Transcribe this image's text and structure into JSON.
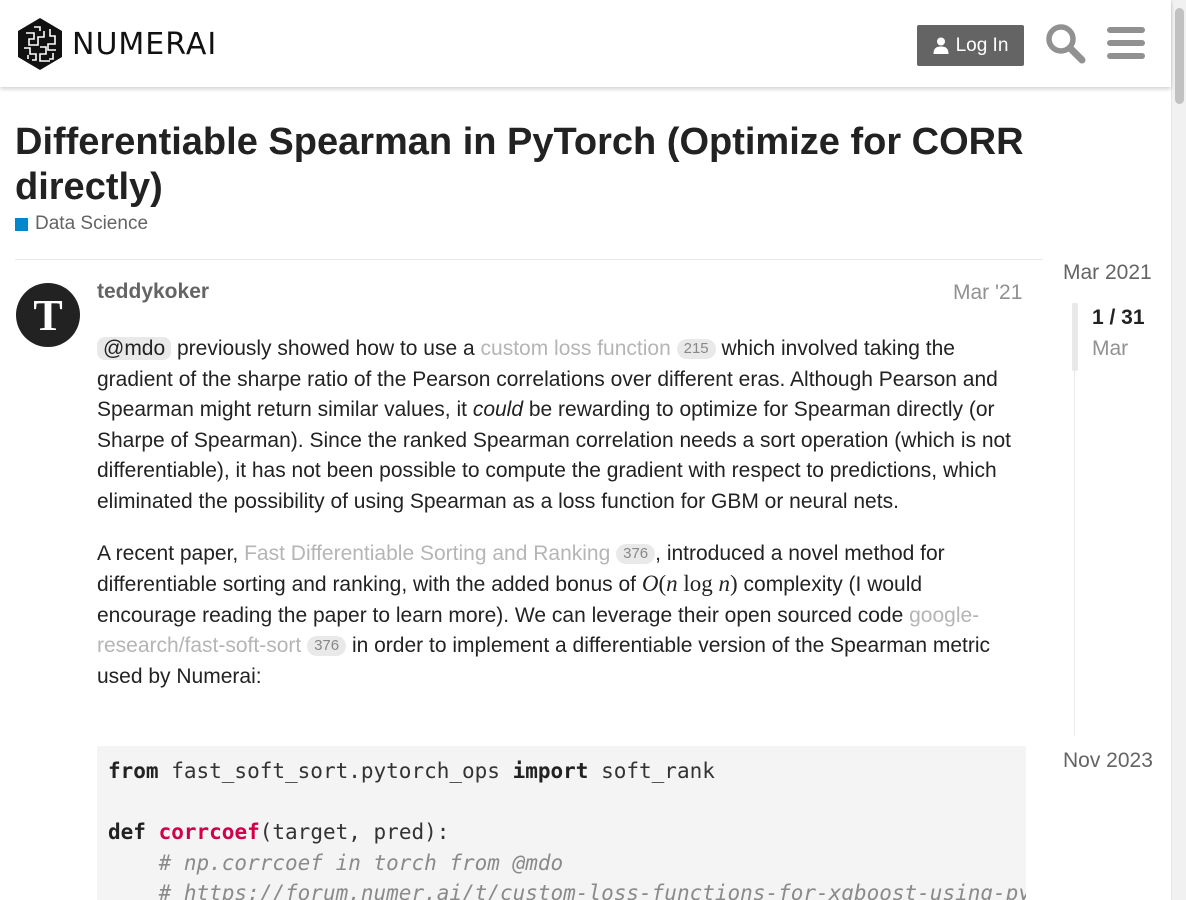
{
  "header": {
    "logo_text": "NUMERAI",
    "login_label": "Log In",
    "icons": [
      "numerai-logo-icon",
      "user-icon",
      "search-icon",
      "hamburger-menu-icon"
    ]
  },
  "topic": {
    "title": "Differentiable Spearman in PyTorch (Optimize for CORR directly)",
    "category": "Data Science",
    "category_color": "#0088cc"
  },
  "post": {
    "avatar_letter": "T",
    "username": "teddykoker",
    "date": "Mar '21",
    "p1": {
      "mention": "@mdo",
      "t1": " previously showed how to use a ",
      "link": "custom loss function",
      "clicks": "215",
      "t2": " which involved taking the gradient of the sharpe ratio of the Pearson correlations over different eras. Although Pearson and Spearman might return similar values, it ",
      "em": "could",
      "t3": " be rewarding to optimize for Spearman directly (or Sharpe of Spearman). Since the ranked Spearman correlation needs a sort operation (which is not differentiable), it has not been possible to compute the gradient with respect to predictions, which eliminated the possibility of using Spearman as a loss function for GBM or neural nets."
    },
    "p2": {
      "t1": "A recent paper, ",
      "link1": "Fast Differentiable Sorting and Ranking",
      "clicks1": "376",
      "t2": ", introduced a novel method for differentiable sorting and ranking, with the added bonus of ",
      "t3": " complexity (I would encourage reading the paper to learn more). We can leverage their open sourced code ",
      "link2": "google-research/fast-soft-sort",
      "clicks2": "376",
      "t4": " in order to implement a differentiable version of the Spearman metric used by Numerai:"
    },
    "code": {
      "l1_kw1": "from",
      "l1_mod": " fast_soft_sort.pytorch_ops ",
      "l1_kw2": "import",
      "l1_name": " soft_rank",
      "l3_kw": "def",
      "l3_fn": "corrcoef",
      "l3_args": "(target, pred):",
      "l4_cm": "# np.corrcoef in torch from @mdo",
      "l5_cm": "# https://forum.numer.ai/t/custom-loss-functions-for-xgboost-using-pytorch"
    }
  },
  "timeline": {
    "start": "Mar 2021",
    "position": "1 / 31",
    "current_date": "Mar",
    "end": "Nov 2023"
  }
}
